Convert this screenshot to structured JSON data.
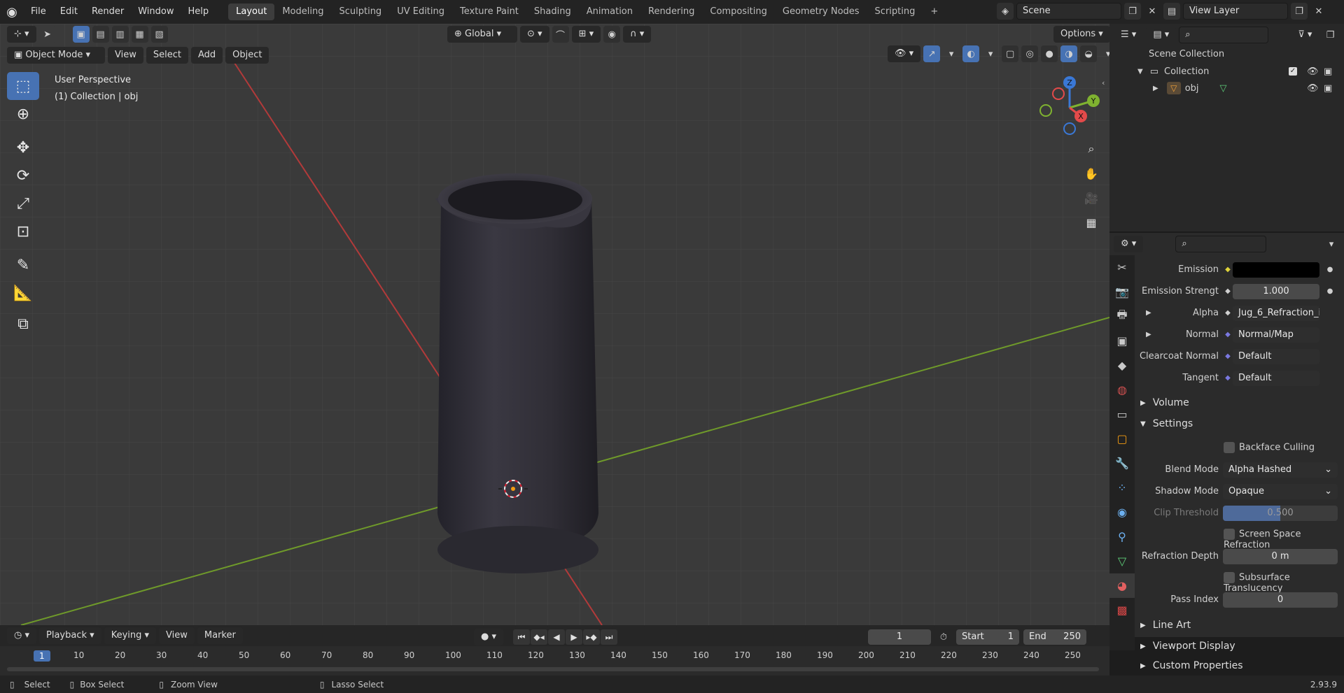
{
  "topbar": {
    "menus": [
      "File",
      "Edit",
      "Render",
      "Window",
      "Help"
    ],
    "workspaces": [
      "Layout",
      "Modeling",
      "Sculpting",
      "UV Editing",
      "Texture Paint",
      "Shading",
      "Animation",
      "Rendering",
      "Compositing",
      "Geometry Nodes",
      "Scripting"
    ],
    "active_workspace": "Layout",
    "add_tab": "+",
    "scene": "Scene",
    "view_layer": "View Layer"
  },
  "viewport_header": {
    "transform_orientation": "Global",
    "options": "Options",
    "mode": "Object Mode",
    "menus": [
      "View",
      "Select",
      "Add",
      "Object"
    ]
  },
  "viewport": {
    "perspective": "User Perspective",
    "collection_info": "(1) Collection | obj",
    "gizmo": {
      "z": "Z",
      "y": "Y",
      "x": "X"
    }
  },
  "outliner": {
    "root": "Scene Collection",
    "collection": "Collection",
    "object": "obj"
  },
  "properties": {
    "rows": [
      {
        "label": "Emission",
        "value": "",
        "swatch": "#000000"
      },
      {
        "label": "Emission Strengt",
        "value": "1.000"
      },
      {
        "label": "Alpha",
        "value": "Jug_6_Refraction_in..."
      },
      {
        "label": "Normal",
        "value": "Normal/Map"
      },
      {
        "label": "Clearcoat Normal",
        "value": "Default"
      },
      {
        "label": "Tangent",
        "value": "Default"
      }
    ],
    "sections": {
      "volume": "Volume",
      "settings": "Settings",
      "line_art": "Line Art",
      "viewport_display": "Viewport Display",
      "custom_properties": "Custom Properties"
    },
    "settings": {
      "backface_culling": "Backface Culling",
      "blend_mode_label": "Blend Mode",
      "blend_mode": "Alpha Hashed",
      "shadow_mode_label": "Shadow Mode",
      "shadow_mode": "Opaque",
      "clip_threshold_label": "Clip Threshold",
      "clip_threshold": "0.500",
      "ssr": "Screen Space Refraction",
      "refraction_depth_label": "Refraction Depth",
      "refraction_depth": "0 m",
      "subsurface": "Subsurface Translucency",
      "pass_index_label": "Pass Index",
      "pass_index": "0"
    }
  },
  "timeline": {
    "menus": [
      "Playback",
      "Keying",
      "View",
      "Marker"
    ],
    "current_frame": "1",
    "start_label": "Start",
    "start": "1",
    "end_label": "End",
    "end": "250",
    "ruler": [
      "1",
      "10",
      "20",
      "30",
      "40",
      "50",
      "60",
      "70",
      "80",
      "90",
      "100",
      "110",
      "120",
      "130",
      "140",
      "150",
      "160",
      "170",
      "180",
      "190",
      "200",
      "210",
      "220",
      "230",
      "240",
      "250"
    ]
  },
  "statusbar": {
    "select": "Select",
    "box_select": "Box Select",
    "zoom_view": "Zoom View",
    "lasso_select": "Lasso Select",
    "version": "2.93.9"
  },
  "colors": {
    "accent": "#4772b3",
    "x_axis": "#e34a4a",
    "y_axis": "#7fb230",
    "z_axis": "#3a78d6",
    "jug": "#2e2c33"
  }
}
